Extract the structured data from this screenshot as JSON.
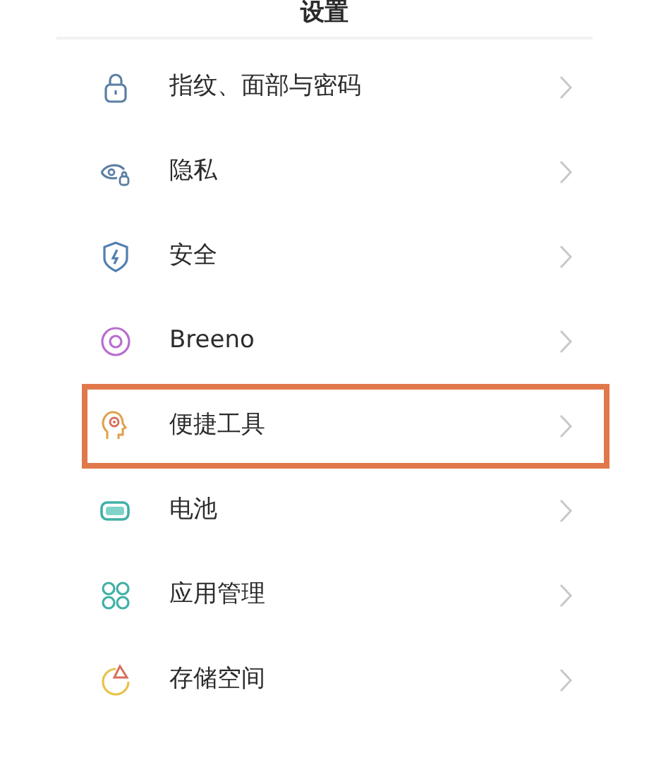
{
  "title": "设置",
  "items": [
    {
      "label": "指纹、面部与密码",
      "highlighted": false
    },
    {
      "label": "隐私",
      "highlighted": false
    },
    {
      "label": "安全",
      "highlighted": false
    },
    {
      "label": "Breeno",
      "highlighted": false
    },
    {
      "label": "便捷工具",
      "highlighted": true
    },
    {
      "label": "电池",
      "highlighted": false
    },
    {
      "label": "应用管理",
      "highlighted": false
    },
    {
      "label": "存储空间",
      "highlighted": false
    }
  ]
}
